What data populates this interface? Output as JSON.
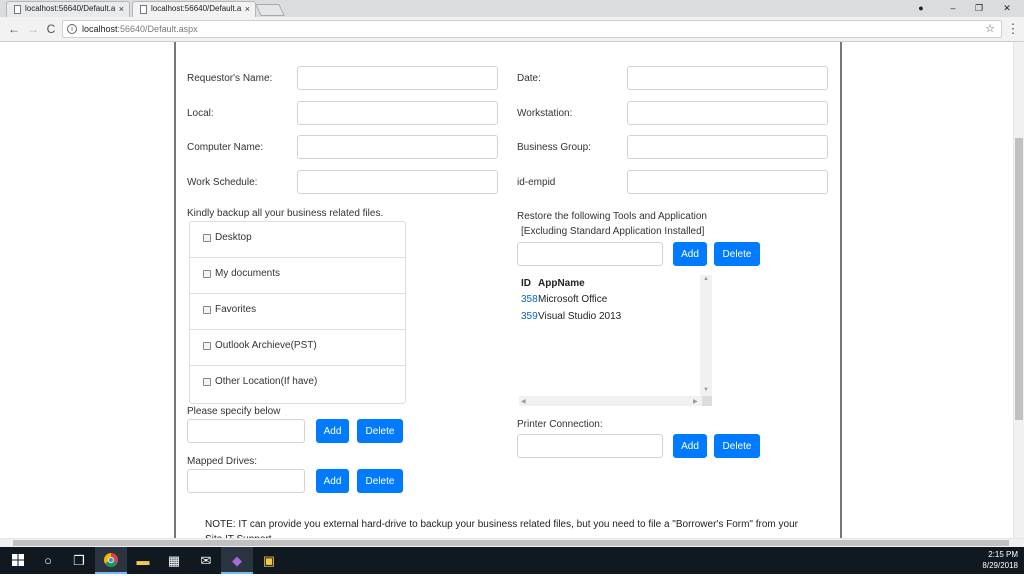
{
  "browser": {
    "tabs": [
      {
        "label": "localhost:56640/Default.a",
        "close": "×"
      },
      {
        "label": "localhost:56640/Default.a",
        "close": "×"
      }
    ],
    "window_controls": {
      "minimize": "–",
      "restore": "❐",
      "close": "✕"
    },
    "back": "←",
    "forward": "→",
    "reload": "C",
    "url_host": "localhost",
    "url_path": ":56640/Default.aspx",
    "star": "☆",
    "menu": "⋮"
  },
  "form": {
    "left_fields": [
      {
        "label": "Requestor's Name:",
        "value": ""
      },
      {
        "label": "Local:",
        "value": ""
      },
      {
        "label": "Computer Name:",
        "value": ""
      },
      {
        "label": "Work Schedule:",
        "value": ""
      }
    ],
    "right_fields": [
      {
        "label": "Date:",
        "value": ""
      },
      {
        "label": "Workstation:",
        "value": ""
      },
      {
        "label": "Business Group:",
        "value": ""
      },
      {
        "label": "id-empid",
        "value": ""
      }
    ],
    "backup_heading": "Kindly backup all your business related files.",
    "backup_items": [
      {
        "label": "Desktop",
        "checked": false
      },
      {
        "label": "My documents",
        "checked": false
      },
      {
        "label": "Favorites",
        "checked": false
      },
      {
        "label": "Outlook Archieve(PST)",
        "checked": false
      },
      {
        "label": "Other Location(If have)",
        "checked": false
      }
    ],
    "specify_label": "Please specify below",
    "specify_value": "",
    "mapped_label": "Mapped Drives:",
    "mapped_value": "",
    "add_label": "Add",
    "delete_label": "Delete",
    "restore_heading_1": "Restore the following Tools and Application",
    "restore_heading_2": "[Excluding Standard Application Installed]",
    "restore_value": "",
    "app_table": {
      "headers": [
        "ID",
        "AppName"
      ],
      "rows": [
        {
          "id": "358",
          "name": "Microsoft Office"
        },
        {
          "id": "359",
          "name": "Visual Studio 2013"
        }
      ]
    },
    "printer_label": "Printer Connection:",
    "printer_value": "",
    "note": "NOTE: IT can provide you external hard-drive to backup your business related files, but you need to file a \"Borrower's Form\" from your Site IT Support."
  },
  "taskbar": {
    "icons": [
      "windows-start-icon",
      "cortana-icon",
      "task-view-icon",
      "chrome-icon",
      "file-explorer-icon",
      "store-icon",
      "mail-icon",
      "visual-studio-icon",
      "app-icon"
    ],
    "time": "2:15 PM",
    "date": "8/29/2018"
  }
}
